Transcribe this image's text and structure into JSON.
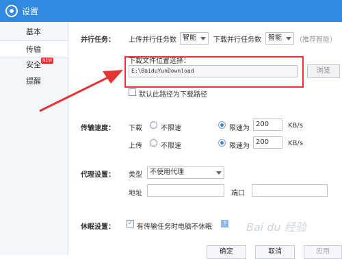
{
  "window": {
    "title": "设置"
  },
  "sidebar": {
    "items": [
      {
        "label": "基本"
      },
      {
        "label": "传输"
      },
      {
        "label": "安全",
        "badge": "NEW"
      },
      {
        "label": "提醒"
      }
    ]
  },
  "parallel": {
    "section": "并行任务：",
    "upload_label": "上传并行任务数",
    "upload_value": "智能",
    "download_label": "下载并行任务数",
    "download_value": "智能",
    "recommend": "（推荐智能）"
  },
  "download_location": {
    "label": "下载文件位置选择：",
    "path": "E:\\BaiduYunDownload",
    "browse": "浏览",
    "default_checkbox": "默认此路径为下载路径"
  },
  "speed": {
    "section": "传输速度：",
    "download": "下载",
    "upload": "上传",
    "unlimited": "不限速",
    "limit_to": "限速为",
    "download_limit": "200",
    "upload_limit": "200",
    "unit": "KB/s"
  },
  "proxy": {
    "section": "代理设置：",
    "type_label": "类型",
    "type_value": "不使用代理",
    "address_label": "地址",
    "port_label": "端口"
  },
  "sleep": {
    "section": "休眠设置：",
    "checkbox": "有传输任务时电脑不休眠"
  },
  "footer": {
    "confirm": "确定",
    "cancel": "取消",
    "apply": "应用"
  },
  "watermark": "Bai du 经验",
  "colors": {
    "accent": "#2f8ae0",
    "annotation": "#e33333"
  }
}
